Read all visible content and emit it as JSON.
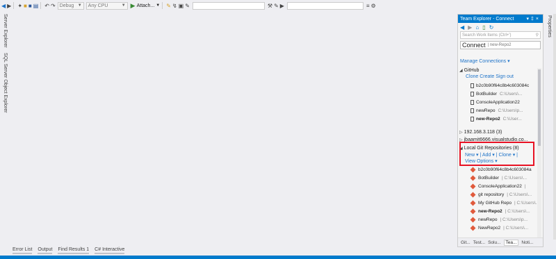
{
  "toolbar": {
    "config": "Debug",
    "platform": "Any CPU",
    "attach_label": "Attach..."
  },
  "left_tabs": [
    "Server Explorer",
    "SQL Server Object Explorer"
  ],
  "right_tab": "Properties",
  "team_explorer": {
    "title": "Team Explorer - Connect",
    "search_placeholder": "Search Work Items (Ctrl+')",
    "connect_label": "Connect",
    "connect_repo": "new-Repo2",
    "manage_connections": "Manage Connections",
    "github": {
      "label": "GitHub",
      "links": [
        "Clone",
        "Create",
        "Sign out"
      ],
      "repos": [
        {
          "name": "b2c0b90f64c8b4c603084c",
          "path": ""
        },
        {
          "name": "BotBuilder",
          "path": "C:\\Users\\..."
        },
        {
          "name": "ConsoleApplication22",
          "path": ""
        },
        {
          "name": "newRepo",
          "path": "C:\\Users\\p..."
        },
        {
          "name": "new-Repo2",
          "path": "C:\\User..."
        }
      ]
    },
    "server1": "192.168.3.118 (3)",
    "server2": "jbaamit6666.visualstudio.co...",
    "local": {
      "label": "Local Git Repositories (8)",
      "new": "New",
      "add": "Add",
      "clone": "Clone",
      "view_options": "View Options",
      "repos": [
        {
          "name": "b2c0b90f64c8b4c603084a",
          "path": ""
        },
        {
          "name": "BotBuilder",
          "path": "C:\\Users\\..."
        },
        {
          "name": "ConsoleApplication22",
          "path": ""
        },
        {
          "name": "git repository",
          "path": "C:\\Users\\..."
        },
        {
          "name": "My GitHub Repo",
          "path": "C:\\Users\\..."
        },
        {
          "name": "new-Repo2",
          "path": "C:\\Users\\..."
        },
        {
          "name": "newRepo",
          "path": "C:\\Users\\p..."
        },
        {
          "name": "NewRepo2",
          "path": "C:\\Users\\..."
        }
      ]
    },
    "tabs": [
      "Git...",
      "Test...",
      "Solu...",
      "Tea...",
      "Noti..."
    ]
  },
  "bottom_tabs": [
    "Error List",
    "Output",
    "Find Results 1",
    "C# Interactive"
  ],
  "colors": {
    "accent": "#007acc",
    "highlight": "#e81123",
    "git": "#e05a3c"
  }
}
